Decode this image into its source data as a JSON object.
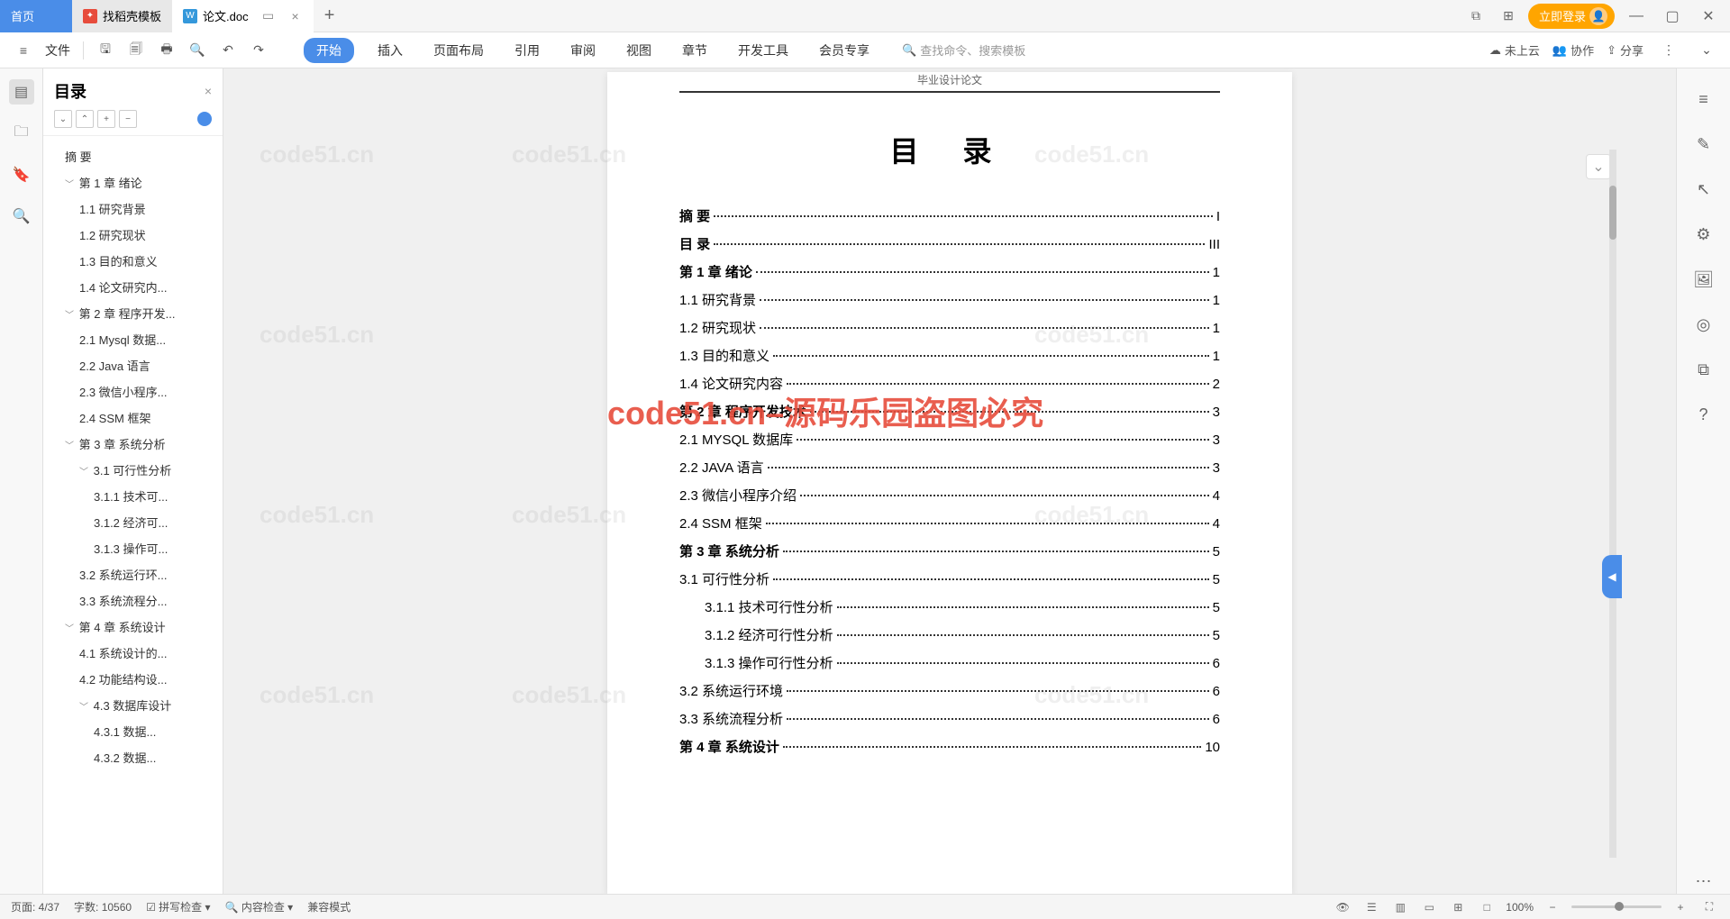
{
  "tabs": {
    "home": "首页",
    "t1": "找稻壳模板",
    "t2": "论文.doc"
  },
  "titleRight": {
    "login": "立即登录"
  },
  "toolbar": {
    "file": "文件"
  },
  "menu": {
    "start": "开始",
    "insert": "插入",
    "layout": "页面布局",
    "ref": "引用",
    "review": "审阅",
    "view": "视图",
    "chapter": "章节",
    "dev": "开发工具",
    "member": "会员专享",
    "search": "查找命令、搜索模板"
  },
  "toolbarRight": {
    "cloud": "未上云",
    "coop": "协作",
    "share": "分享"
  },
  "outline": {
    "title": "目录",
    "items": [
      {
        "lvl": 1,
        "chev": "",
        "txt": "摘  要"
      },
      {
        "lvl": 1,
        "chev": "﹀",
        "txt": "第 1 章 绪论"
      },
      {
        "lvl": 2,
        "chev": "",
        "txt": "1.1 研究背景"
      },
      {
        "lvl": 2,
        "chev": "",
        "txt": "1.2 研究现状"
      },
      {
        "lvl": 2,
        "chev": "",
        "txt": "1.3 目的和意义"
      },
      {
        "lvl": 2,
        "chev": "",
        "txt": "1.4 论文研究内..."
      },
      {
        "lvl": 1,
        "chev": "﹀",
        "txt": "第 2 章 程序开发..."
      },
      {
        "lvl": 2,
        "chev": "",
        "txt": "2.1 Mysql 数据..."
      },
      {
        "lvl": 2,
        "chev": "",
        "txt": "2.2 Java 语言"
      },
      {
        "lvl": 2,
        "chev": "",
        "txt": "2.3 微信小程序..."
      },
      {
        "lvl": 2,
        "chev": "",
        "txt": "2.4 SSM 框架"
      },
      {
        "lvl": 1,
        "chev": "﹀",
        "txt": "第 3 章 系统分析"
      },
      {
        "lvl": 2,
        "chev": "﹀",
        "txt": "3.1 可行性分析"
      },
      {
        "lvl": 3,
        "chev": "",
        "txt": "3.1.1 技术可..."
      },
      {
        "lvl": 3,
        "chev": "",
        "txt": "3.1.2 经济可..."
      },
      {
        "lvl": 3,
        "chev": "",
        "txt": "3.1.3 操作可..."
      },
      {
        "lvl": 2,
        "chev": "",
        "txt": "3.2 系统运行环..."
      },
      {
        "lvl": 2,
        "chev": "",
        "txt": "3.3 系统流程分..."
      },
      {
        "lvl": 1,
        "chev": "﹀",
        "txt": "第 4 章 系统设计"
      },
      {
        "lvl": 2,
        "chev": "",
        "txt": "4.1 系统设计的..."
      },
      {
        "lvl": 2,
        "chev": "",
        "txt": "4.2 功能结构设..."
      },
      {
        "lvl": 2,
        "chev": "﹀",
        "txt": "4.3 数据库设计"
      },
      {
        "lvl": 3,
        "chev": "",
        "txt": "4.3.1 数据..."
      },
      {
        "lvl": 3,
        "chev": "",
        "txt": "4.3.2 数据..."
      }
    ]
  },
  "doc": {
    "header": "毕业设计论文",
    "title": "目  录",
    "toc": [
      {
        "bold": true,
        "indent": 0,
        "txt": "摘    要",
        "pg": "I"
      },
      {
        "bold": true,
        "indent": 0,
        "txt": "目    录",
        "pg": "III"
      },
      {
        "bold": true,
        "indent": 0,
        "txt": "第 1 章  绪论",
        "pg": "1"
      },
      {
        "bold": false,
        "indent": 0,
        "txt": "1.1  研究背景",
        "pg": "1"
      },
      {
        "bold": false,
        "indent": 0,
        "txt": "1.2  研究现状",
        "pg": "1"
      },
      {
        "bold": false,
        "indent": 0,
        "txt": "1.3  目的和意义",
        "pg": "1"
      },
      {
        "bold": false,
        "indent": 0,
        "txt": "1.4  论文研究内容",
        "pg": "2"
      },
      {
        "bold": true,
        "indent": 0,
        "txt": "第 2 章  程序开发技术",
        "pg": "3"
      },
      {
        "bold": false,
        "indent": 0,
        "txt": "2.1 MYSQL 数据库",
        "pg": "3"
      },
      {
        "bold": false,
        "indent": 0,
        "txt": "2.2 JAVA 语言",
        "pg": "3"
      },
      {
        "bold": false,
        "indent": 0,
        "txt": "2.3  微信小程序介绍",
        "pg": "4"
      },
      {
        "bold": false,
        "indent": 0,
        "txt": "2.4 SSM 框架",
        "pg": "4"
      },
      {
        "bold": true,
        "indent": 0,
        "txt": "第 3 章  系统分析",
        "pg": "5"
      },
      {
        "bold": false,
        "indent": 0,
        "txt": "3.1 可行性分析",
        "pg": "5"
      },
      {
        "bold": false,
        "indent": 1,
        "txt": "3.1.1 技术可行性分析",
        "pg": "5"
      },
      {
        "bold": false,
        "indent": 1,
        "txt": "3.1.2 经济可行性分析",
        "pg": "5"
      },
      {
        "bold": false,
        "indent": 1,
        "txt": "3.1.3 操作可行性分析",
        "pg": "6"
      },
      {
        "bold": false,
        "indent": 0,
        "txt": "3.2 系统运行环境",
        "pg": "6"
      },
      {
        "bold": false,
        "indent": 0,
        "txt": "3.3 系统流程分析",
        "pg": "6"
      },
      {
        "bold": true,
        "indent": 0,
        "txt": "第 4 章  系统设计",
        "pg": "10"
      }
    ],
    "watermark": "code51.cn–源码乐园盗图必究",
    "wmText": "code51.cn"
  },
  "status": {
    "page": "页面: 4/37",
    "words": "字数: 10560",
    "spell": "拼写检查",
    "content": "内容检查",
    "compat": "兼容模式",
    "zoom": "100%"
  }
}
